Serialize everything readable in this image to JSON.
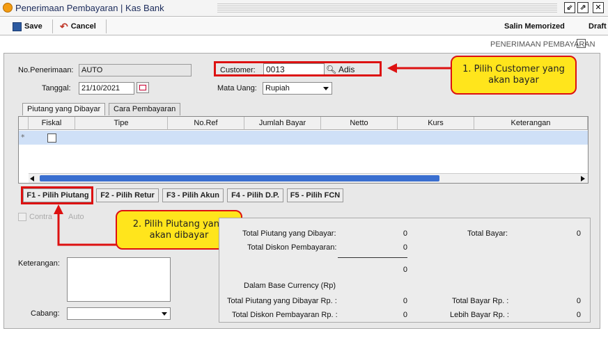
{
  "window": {
    "title": "Penerimaan Pembayaran | Kas Bank"
  },
  "toolbar": {
    "save": "Save",
    "cancel": "Cancel",
    "salin": "Salin Memorized",
    "draft": "Draft"
  },
  "header": {
    "section_title": "PENERIMAAN PEMBAYARAN"
  },
  "form": {
    "no_label": "No.Penerimaan:",
    "no_value": "AUTO",
    "tanggal_label": "Tanggal:",
    "tanggal_value": "21/10/2021",
    "customer_label": "Customer:",
    "customer_value": "0013",
    "customer_name": "Adis",
    "mata_uang_label": "Mata Uang:",
    "mata_uang_value": "Rupiah"
  },
  "tabs": [
    {
      "label": "Piutang yang Dibayar"
    },
    {
      "label": "Cara Pembayaran"
    }
  ],
  "table": {
    "columns": [
      "Fiskal",
      "Tipe",
      "No.Ref",
      "Jumlah Bayar",
      "Netto",
      "Kurs",
      "Keterangan"
    ],
    "row_marker": "*"
  },
  "buttons": {
    "f1": "F1 - Pilih Piutang",
    "f2": "F2 - Pilih Retur",
    "f3": "F3 - Pilih Akun",
    "f4": "F4 - Pilih D.P.",
    "f5": "F5 - Pilih FCN"
  },
  "options": {
    "contra": "Contra",
    "auto": "Auto"
  },
  "bottom": {
    "keterangan_label": "Keterangan:",
    "cabang_label": "Cabang:"
  },
  "summary": {
    "total_piutang": "Total Piutang yang Dibayar:",
    "total_piutang_val": "0",
    "total_diskon": "Total Diskon Pembayaran:",
    "total_diskon_val": "0",
    "subtotal_val": "0",
    "total_bayar": "Total Bayar:",
    "total_bayar_val": "0",
    "base_currency": "Dalam Base Currency (Rp)",
    "total_piutang_rp": "Total Piutang yang Dibayar Rp. :",
    "total_piutang_rp_val": "0",
    "total_diskon_rp": "Total Diskon Pembayaran Rp. :",
    "total_diskon_rp_val": "0",
    "total_bayar_rp": "Total Bayar Rp. :",
    "total_bayar_rp_val": "0",
    "lebih_bayar_rp": "Lebih Bayar Rp. :",
    "lebih_bayar_rp_val": "0"
  },
  "callouts": {
    "one": "1. Pilih Customer yang akan bayar",
    "two": "2. Pilih Piutang yang akan dibayar"
  },
  "colors": {
    "callout_fill": "#ffe51c",
    "annotation_red": "#d11111",
    "grid_row_selected": "#cfe0f7",
    "scrollbar": "#3a6fd0"
  }
}
